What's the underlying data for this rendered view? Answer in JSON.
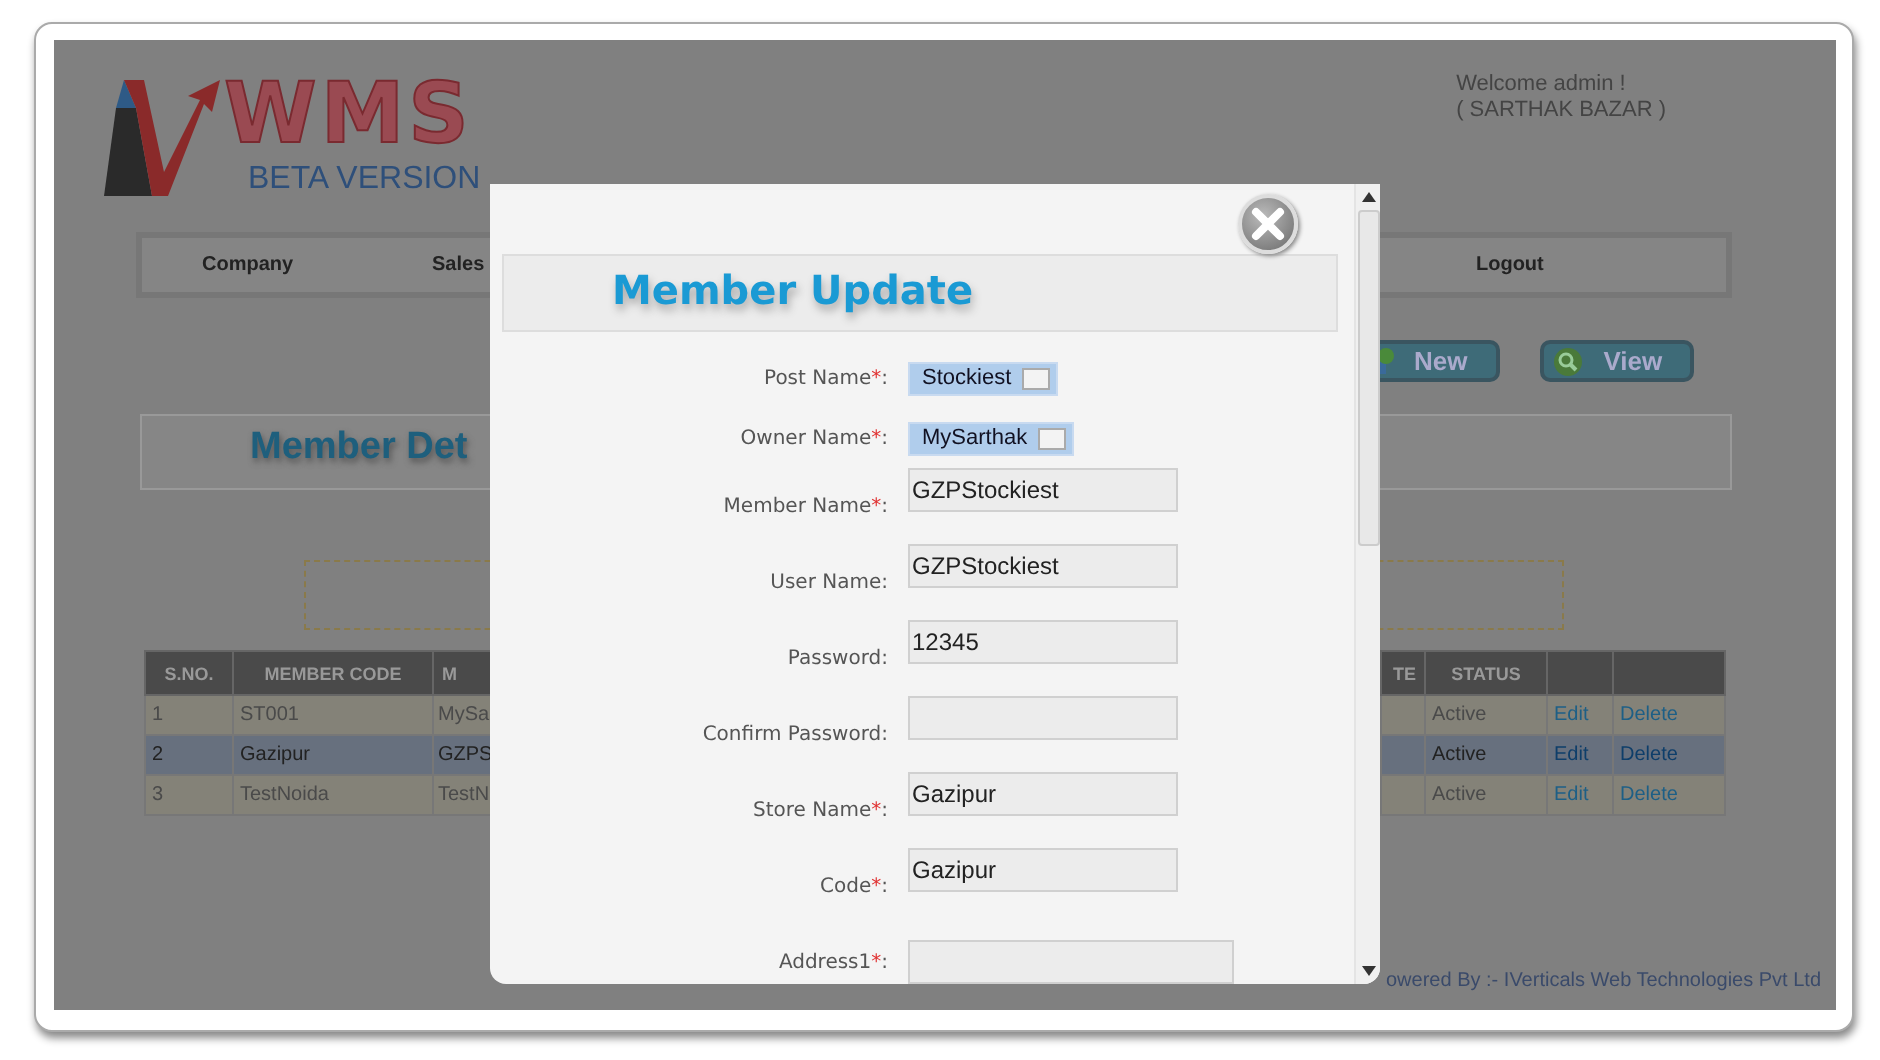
{
  "header": {
    "logo_title": "WMS",
    "logo_subtitle": "BETA VERSION",
    "welcome": "Welcome admin !",
    "company": "( SARTHAK BAZAR )"
  },
  "nav": [
    {
      "label": "Company"
    },
    {
      "label": "Sales"
    },
    {
      "label": "Logout"
    }
  ],
  "actions": [
    {
      "label": "New",
      "kind": "new"
    },
    {
      "label": "View",
      "kind": "view"
    }
  ],
  "page_title": "Member Det",
  "table": {
    "columns": [
      "S.NO.",
      "MEMBER CODE",
      "M",
      "TE",
      "STATUS"
    ],
    "rows": [
      {
        "s_no": "1",
        "member_code": "ST001",
        "column_3": "MySa",
        "status": "Active",
        "links": [
          "Edit",
          "Delete"
        ],
        "selected": false
      },
      {
        "s_no": "2",
        "member_code": "Gazipur",
        "column_3": "GZPS",
        "status": "Active",
        "links": [
          "Edit",
          "Delete"
        ],
        "selected": true
      },
      {
        "s_no": "3",
        "member_code": "TestNoida",
        "column_3": "TestN",
        "status": "Active",
        "links": [
          "Edit",
          "Delete"
        ],
        "selected": false
      }
    ]
  },
  "footer": "owered By :- IVerticals Web Technologies Pvt Ltd",
  "dialog": {
    "title": "Member Update",
    "fields": [
      {
        "kind": "select",
        "label": "Post Name",
        "asterisk": "*",
        "suffix": ":",
        "value": "Stockiest"
      },
      {
        "kind": "select",
        "label": "Owner Name",
        "asterisk": "*",
        "suffix": ":",
        "value": "MySarthak"
      },
      {
        "kind": "input",
        "label": "Member Name",
        "asterisk": "*",
        "suffix": ":",
        "value": "GZPStockiest"
      },
      {
        "kind": "input",
        "label": "User Name:",
        "value": "GZPStockiest"
      },
      {
        "kind": "input",
        "label": "Password:",
        "value": "12345"
      },
      {
        "kind": "input",
        "label": "Confirm Password:"
      },
      {
        "kind": "input",
        "label": "Store Name",
        "asterisk": "*",
        "suffix": ":",
        "value": "Gazipur"
      },
      {
        "kind": "input",
        "label": "Code",
        "asterisk": "*",
        "suffix": ":",
        "value": "Gazipur"
      },
      {
        "kind": "wide",
        "label": "Address1",
        "asterisk": "*",
        "suffix": ":"
      }
    ]
  }
}
